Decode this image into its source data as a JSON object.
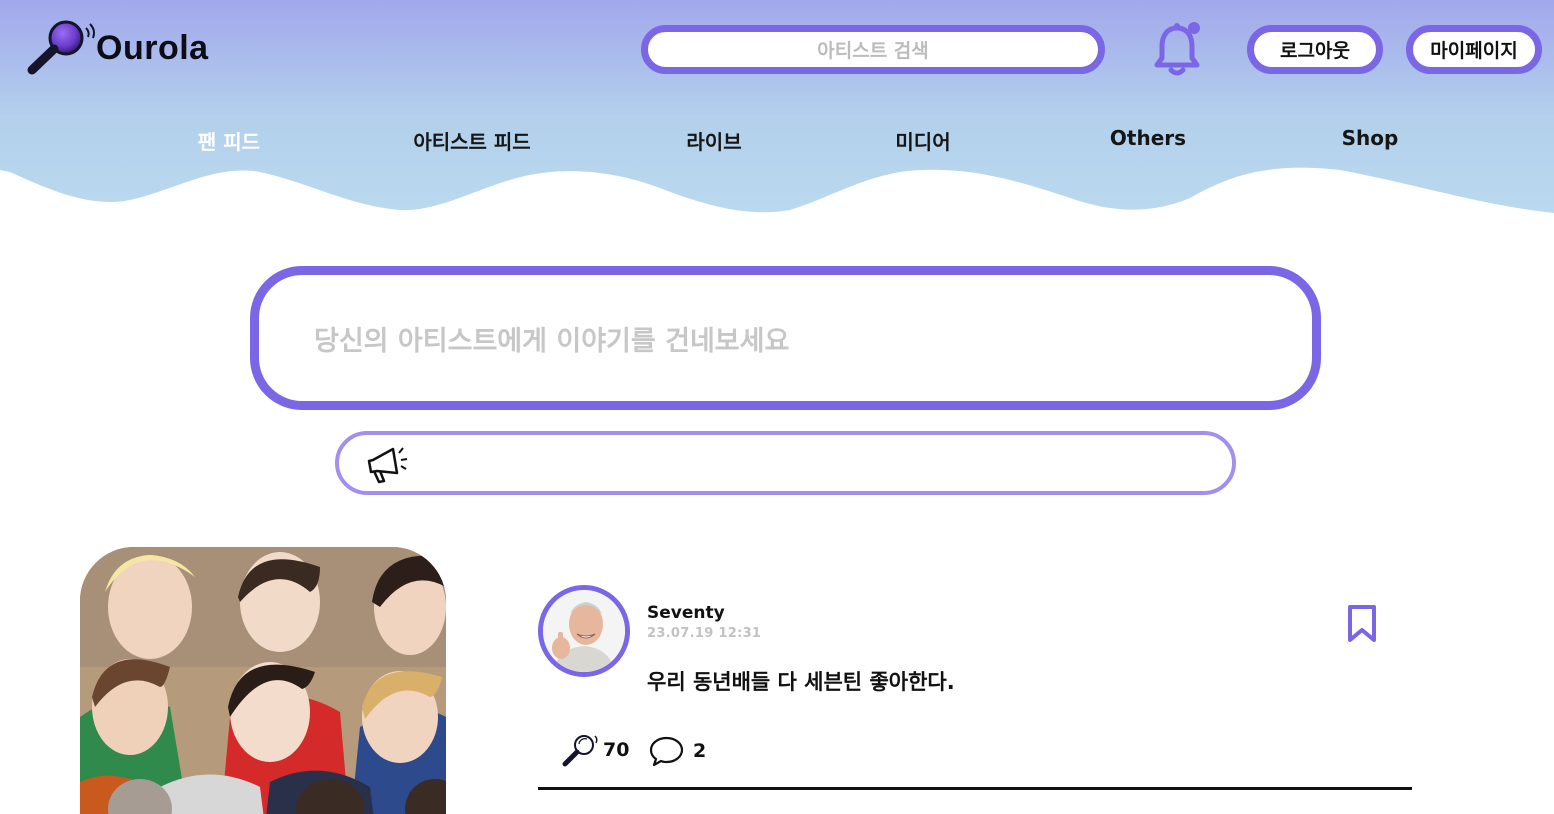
{
  "header": {
    "logo_text": "Ourola",
    "search_placeholder": "아티스트 검색",
    "logout_label": "로그아웃",
    "mypage_label": "마이페이지",
    "notification_icon": "bell-icon",
    "nav": [
      {
        "label": "팬 피드",
        "active": true
      },
      {
        "label": "아티스트 피드",
        "active": false
      },
      {
        "label": "라이브",
        "active": false
      },
      {
        "label": "미디어",
        "active": false
      },
      {
        "label": "Others",
        "active": false
      },
      {
        "label": "Shop",
        "active": false
      }
    ]
  },
  "composer": {
    "placeholder": "당신의 아티스트에게 이야기를 건네보세요"
  },
  "notice": {
    "icon": "megaphone-icon",
    "text": ""
  },
  "post": {
    "author": "Seventy",
    "time": "23.07.19  12:31",
    "body": "우리 동년배들 다 세븐틴 좋아한다.",
    "likes": "70",
    "comments": "2",
    "like_icon": "microphone-icon",
    "comment_icon": "speech-bubble-icon",
    "bookmark_icon": "bookmark-icon"
  },
  "colors": {
    "accent": "#7b66e6",
    "header_top": "#a3a9ec",
    "header_bottom": "#b9d8ee",
    "placeholder": "#c7c7c7"
  }
}
